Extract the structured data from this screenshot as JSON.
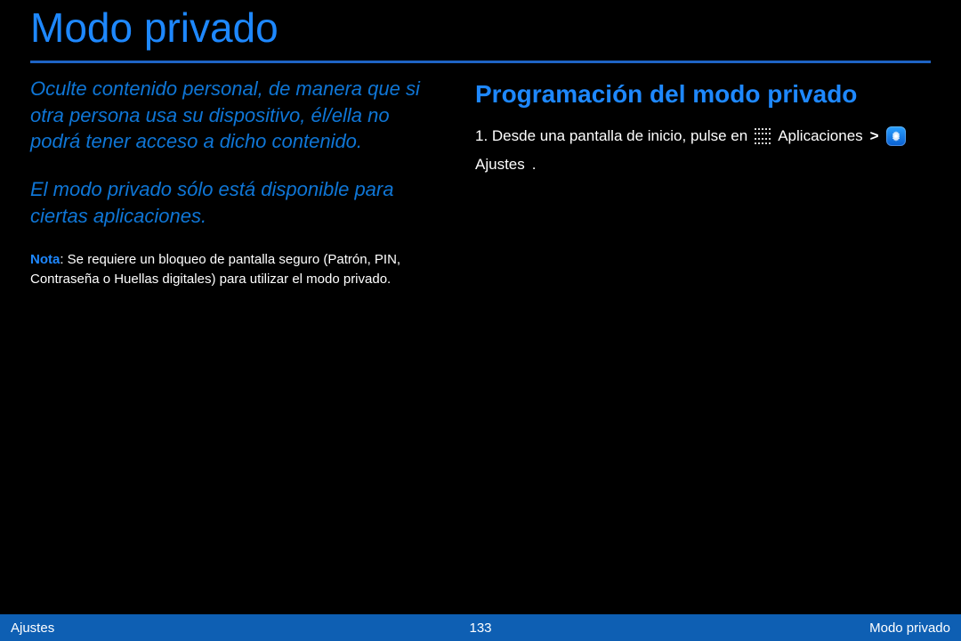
{
  "title": "Modo privado",
  "left": {
    "intro": "Oculte contenido personal, de manera que si otra persona usa su dispositivo, él/ella no podrá tener acceso a dicho contenido.",
    "availability": "El modo privado sólo está disponible para ciertas aplicaciones.",
    "note_label": "Nota",
    "note_text": ": Se requiere un bloqueo de pantalla seguro (Patrón, PIN, Contraseña o Huellas digitales) para utilizar el modo privado."
  },
  "right": {
    "heading": "Programación del modo privado",
    "step_prefix": "1. Desde una pantalla de inicio, pulse en",
    "apps_label": "Aplicaciones",
    "gt": ">",
    "settings_label": "Ajustes",
    "suffix": "."
  },
  "footer": {
    "left": "Ajustes",
    "center": "133",
    "right": "Modo privado"
  }
}
